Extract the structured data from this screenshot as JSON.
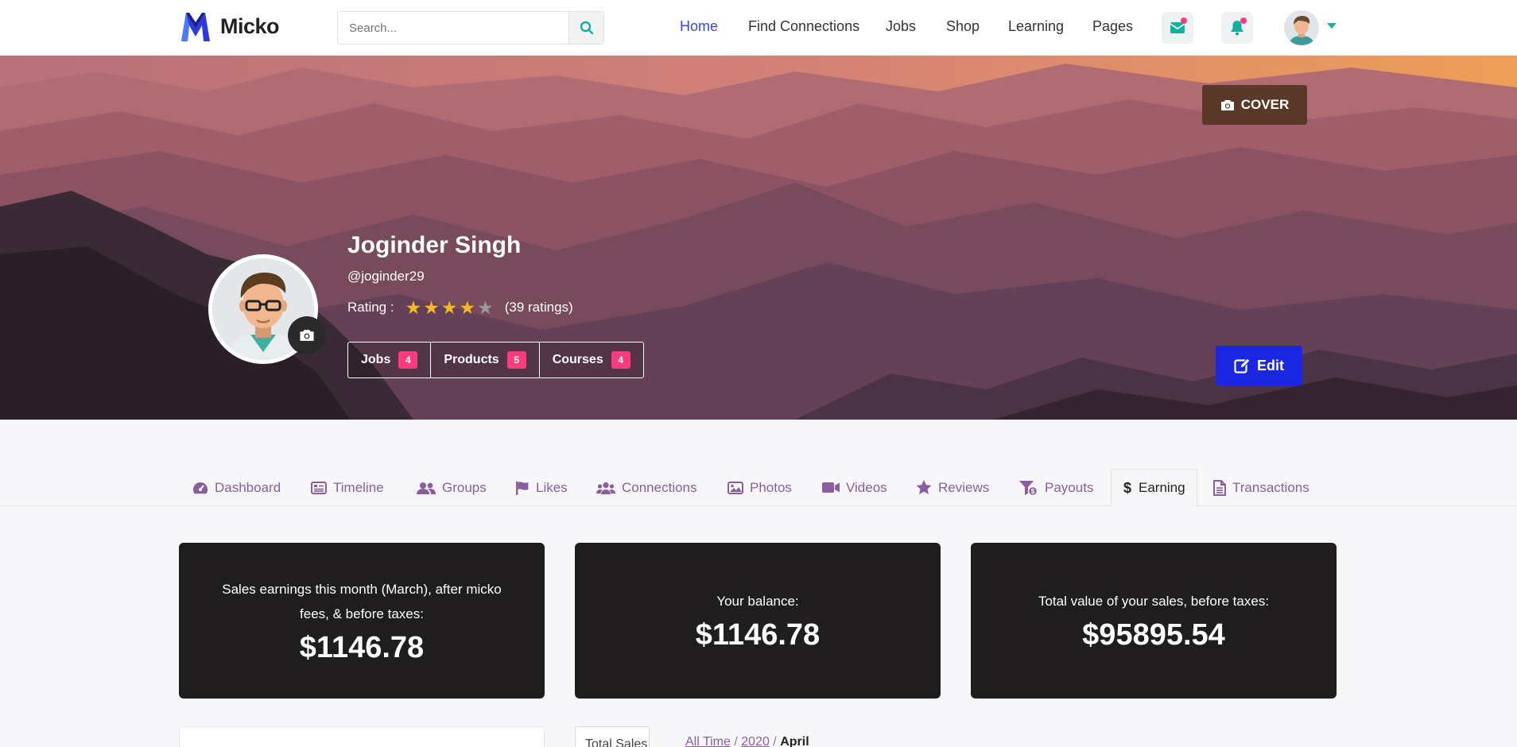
{
  "header": {
    "logo_text": "Micko",
    "search_placeholder": "Search...",
    "nav": [
      "Home",
      "Find Connections",
      "Jobs",
      "Shop",
      "Learning",
      "Pages"
    ],
    "active_nav": "Home",
    "icons": [
      "mail-icon",
      "bell-icon",
      "search-icon"
    ],
    "accent_color": "#13b0a2",
    "nav_active_color": "#3a46d8",
    "notification_dot_color": "#ff3b7f"
  },
  "profile": {
    "cover_button": "COVER",
    "name": "Joginder Singh",
    "username": "@joginder29",
    "rating_label": "Rating :",
    "rating_value": 4,
    "rating_max": 5,
    "rating_count": "(39 ratings)",
    "pills": [
      {
        "label": "Jobs",
        "count": "4"
      },
      {
        "label": "Products",
        "count": "5"
      },
      {
        "label": "Courses",
        "count": "4"
      }
    ],
    "edit_button": "Edit",
    "edit_color": "#1a26e2",
    "star_color": "#f5b820"
  },
  "tabs": [
    {
      "label": "Dashboard",
      "icon": "dashboard-icon"
    },
    {
      "label": "Timeline",
      "icon": "timeline-icon"
    },
    {
      "label": "Groups",
      "icon": "groups-icon"
    },
    {
      "label": "Likes",
      "icon": "flag-icon"
    },
    {
      "label": "Connections",
      "icon": "connections-icon"
    },
    {
      "label": "Photos",
      "icon": "image-icon"
    },
    {
      "label": "Videos",
      "icon": "video-icon"
    },
    {
      "label": "Reviews",
      "icon": "star-icon"
    },
    {
      "label": "Payouts",
      "icon": "payouts-icon"
    },
    {
      "label": "Earning",
      "icon": "dollar-icon"
    },
    {
      "label": "Transactions",
      "icon": "document-icon"
    }
  ],
  "active_tab": "Earning",
  "cards": [
    {
      "label": "Sales earnings this month (March), after micko fees, & before taxes:",
      "amount": "$1146.78"
    },
    {
      "label": "Your balance:",
      "amount": "$1146.78"
    },
    {
      "label": "Total value of your sales, before taxes:",
      "amount": "$95895.54"
    }
  ],
  "filter": {
    "select_value": "Total Sales",
    "breadcrumb": [
      "All Time",
      "2020",
      "April"
    ]
  }
}
